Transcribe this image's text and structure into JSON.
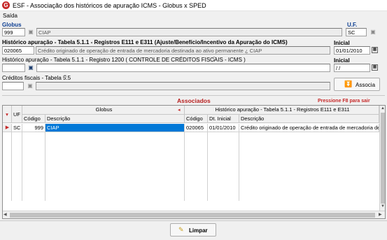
{
  "window": {
    "title": "ESF - Associação dos históricos de apuração ICMS - Globus x SPED",
    "app_icon": "G"
  },
  "menu": {
    "items": [
      "Saída"
    ]
  },
  "globus": {
    "label": "Globus",
    "code": "999",
    "description": "CIAP"
  },
  "uf": {
    "label": "U.F.",
    "value": "SC"
  },
  "historico_apuracao": {
    "label": "Histórico apuração - Tabela 5.1.1 - Registros E111 e E311 (Ajuste/Benefício/Incentivo da Apuração do ICMS)",
    "code": "020065",
    "description": "Crédito originado de operação de entrada de mercadoria destinada ao ativo permanente ¿ CIAP"
  },
  "inicial": {
    "label": "Inicial",
    "value": "01/01/2010"
  },
  "historico_1200": {
    "label": "Histórico apuração - Tabela 5.1.1 - Registro 1200 ( CONTROLE DE CRÉDITOS FISCAIS - ICMS )",
    "code": "",
    "description": ""
  },
  "inicial_2": {
    "label": "Inicial",
    "value": " / / "
  },
  "creditos_fiscais": {
    "label": "Créditos fiscais - Tabela 5.5",
    "code": "",
    "description": ""
  },
  "associa_button": {
    "label": "Associa"
  },
  "associados": {
    "title": "Associados",
    "hint": "Pressione F8 para sair"
  },
  "grid": {
    "group_headers": {
      "globus": "Globus",
      "historico": "Histórico apuração - Tabela 5.1.1 - Registros E111 e E311"
    },
    "columns": {
      "uf": "UF",
      "codigo": "Código",
      "descricao": "Descrição",
      "codigo2": "Código",
      "dt_inicial": "Dt. Inicial",
      "descricao2": "Descrição"
    },
    "rows": [
      {
        "uf": "SC",
        "codigo": "999",
        "descricao": "CIAP",
        "codigo2": "020065",
        "dt_inicial": "01/01/2010",
        "descricao2": "Crédito originado de operação de entrada de mercadoria destinada"
      }
    ]
  },
  "limpar_button": {
    "label": "Limpar"
  },
  "colors": {
    "accent_blue": "#0b3d91",
    "header_red": "#b71c1c",
    "selection": "#0078d7"
  }
}
